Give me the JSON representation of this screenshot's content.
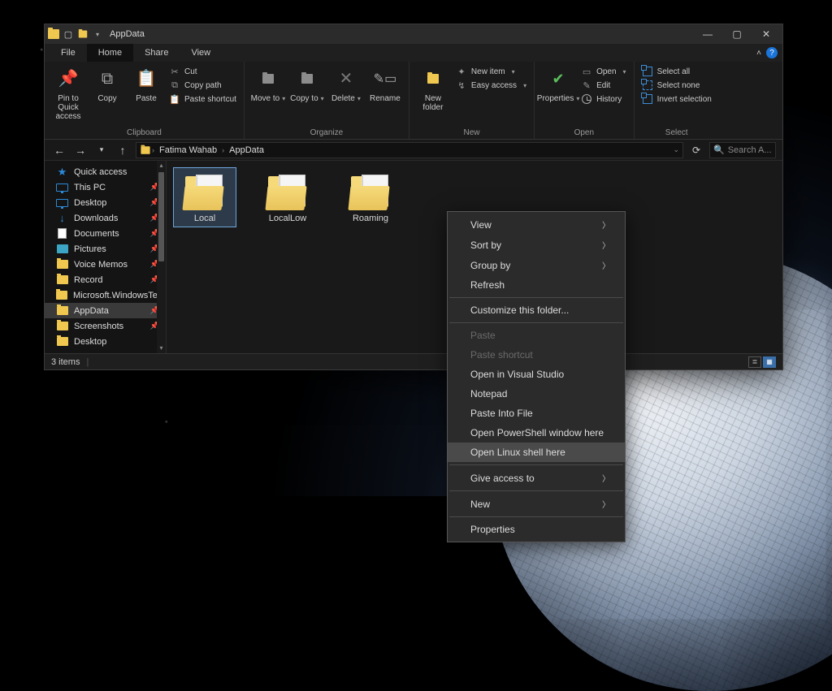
{
  "title": "AppData",
  "tabs": {
    "file": "File",
    "home": "Home",
    "share": "Share",
    "view": "View"
  },
  "ribbon": {
    "clipboard": {
      "label": "Clipboard",
      "pin": "Pin to Quick access",
      "copy": "Copy",
      "paste": "Paste",
      "cut": "Cut",
      "copypath": "Copy path",
      "pasteshort": "Paste shortcut"
    },
    "organize": {
      "label": "Organize",
      "moveto": "Move to",
      "copyto": "Copy to",
      "delete": "Delete",
      "rename": "Rename"
    },
    "new": {
      "label": "New",
      "newfolder": "New folder",
      "newitem": "New item",
      "easyaccess": "Easy access"
    },
    "open": {
      "label": "Open",
      "properties": "Properties",
      "open": "Open",
      "edit": "Edit",
      "history": "History"
    },
    "select": {
      "label": "Select",
      "all": "Select all",
      "none": "Select none",
      "invert": "Invert selection"
    }
  },
  "breadcrumbs": [
    "Fatima Wahab",
    "AppData"
  ],
  "search_placeholder": "Search A...",
  "sidebar": [
    {
      "label": "Quick access",
      "icon": "star",
      "pinned": false
    },
    {
      "label": "This PC",
      "icon": "monitor",
      "pinned": true
    },
    {
      "label": "Desktop",
      "icon": "monitor",
      "pinned": true
    },
    {
      "label": "Downloads",
      "icon": "down",
      "pinned": true
    },
    {
      "label": "Documents",
      "icon": "doc",
      "pinned": true
    },
    {
      "label": "Pictures",
      "icon": "pic",
      "pinned": true
    },
    {
      "label": "Voice Memos",
      "icon": "folder",
      "pinned": true
    },
    {
      "label": "Record",
      "icon": "folder",
      "pinned": true
    },
    {
      "label": "Microsoft.WindowsTe",
      "icon": "folder",
      "pinned": true
    },
    {
      "label": "AppData",
      "icon": "folder",
      "pinned": true,
      "active": true
    },
    {
      "label": "Screenshots",
      "icon": "folder",
      "pinned": true
    },
    {
      "label": "Desktop",
      "icon": "folder",
      "pinned": false
    }
  ],
  "folders": [
    "Local",
    "LocalLow",
    "Roaming"
  ],
  "selected_folder": 0,
  "status": "3 items",
  "context_menu": [
    {
      "label": "View",
      "arrow": true
    },
    {
      "label": "Sort by",
      "arrow": true
    },
    {
      "label": "Group by",
      "arrow": true
    },
    {
      "label": "Refresh"
    },
    {
      "sep": true
    },
    {
      "label": "Customize this folder..."
    },
    {
      "sep": true
    },
    {
      "label": "Paste",
      "disabled": true
    },
    {
      "label": "Paste shortcut",
      "disabled": true
    },
    {
      "label": "Open in Visual Studio"
    },
    {
      "label": "Notepad"
    },
    {
      "label": "Paste Into File"
    },
    {
      "label": "Open PowerShell window here"
    },
    {
      "label": "Open Linux shell here",
      "hover": true
    },
    {
      "sep": true
    },
    {
      "label": "Give access to",
      "arrow": true
    },
    {
      "sep": true
    },
    {
      "label": "New",
      "arrow": true
    },
    {
      "sep": true
    },
    {
      "label": "Properties"
    }
  ]
}
